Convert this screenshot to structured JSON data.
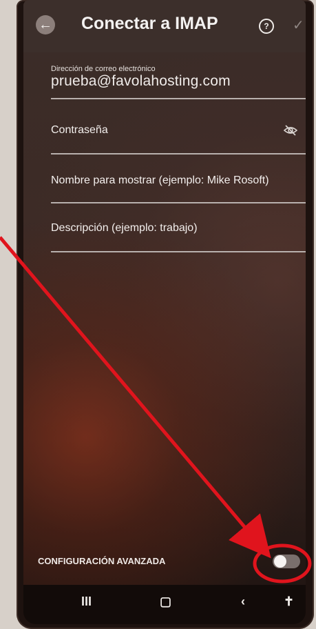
{
  "header": {
    "back_icon": "arrow-left-icon",
    "title": "Conectar a IMAP",
    "help_icon": "question-circle-icon",
    "help_glyph": "?",
    "confirm_icon": "check-icon",
    "confirm_glyph": "✓"
  },
  "form": {
    "email": {
      "label": "Dirección de correo electrónico",
      "value": "prueba@favolahosting.com"
    },
    "password": {
      "label": "Contraseña",
      "visibility_icon": "eye-off-icon"
    },
    "display_name": {
      "label": "Nombre para mostrar (ejemplo: Mike Rosoft)"
    },
    "description": {
      "label": "Descripción (ejemplo: trabajo)"
    }
  },
  "advanced": {
    "label": "CONFIGURACIÓN AVANZADA",
    "enabled": false
  },
  "navbar": {
    "recent": "III",
    "home": "▢",
    "back": "‹",
    "accessibility": "✝"
  },
  "colors": {
    "annotation": "#e0141d",
    "screen_bg": "#3a2c28"
  }
}
